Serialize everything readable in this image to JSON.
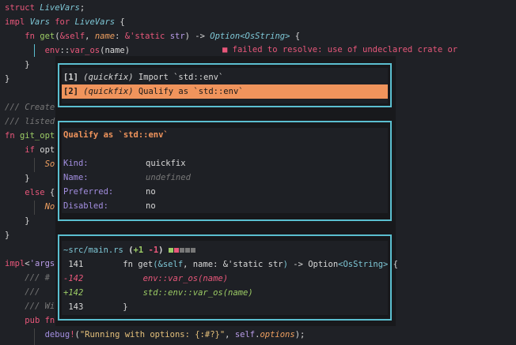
{
  "code": [
    {
      "t": 10,
      "parts": [
        [
          "kw",
          "struct "
        ],
        [
          "ty",
          "LiveVars"
        ],
        [
          "",
          "; "
        ]
      ]
    },
    {
      "t": 28,
      "parts": [
        [
          "kw",
          "impl "
        ],
        [
          "ty",
          "Vars"
        ],
        [
          "kw",
          " for "
        ],
        [
          "ty",
          "LiveVars"
        ],
        [
          "",
          " {"
        ]
      ]
    },
    {
      "t": 46,
      "parts": [
        [
          "",
          "    "
        ],
        [
          "kw",
          "fn "
        ],
        [
          "fn",
          "get"
        ],
        [
          "",
          "("
        ],
        [
          "kw",
          "&self"
        ],
        [
          "",
          ", "
        ],
        [
          "par",
          "name"
        ],
        [
          "",
          ": "
        ],
        [
          "kw",
          "&'static "
        ],
        [
          "self",
          "str"
        ],
        [
          "",
          ") -> "
        ],
        [
          "ty",
          "Option"
        ],
        [
          "ty",
          "<OsString>"
        ],
        [
          "",
          " {"
        ]
      ]
    },
    {
      "t": 64,
      "parts": [
        [
          "",
          "        "
        ],
        [
          "kw",
          "env"
        ],
        [
          "",
          "::"
        ],
        [
          "kw",
          "var_os"
        ],
        [
          "",
          "(name)"
        ]
      ]
    },
    {
      "t": 82,
      "parts": [
        [
          "",
          "    }"
        ]
      ]
    },
    {
      "t": 100,
      "parts": [
        [
          "",
          "}"
        ]
      ]
    },
    {
      "t": 136,
      "parts": [
        [
          "cm",
          "/// Create"
        ]
      ]
    },
    {
      "t": 154,
      "parts": [
        [
          "cm",
          "/// listed"
        ]
      ]
    },
    {
      "t": 172,
      "parts": [
        [
          "kw",
          "fn "
        ],
        [
          "fn",
          "git_opt"
        ]
      ]
    },
    {
      "t": 190,
      "parts": [
        [
          "",
          "    "
        ],
        [
          "kw",
          "if "
        ],
        [
          "",
          "opt"
        ]
      ]
    },
    {
      "t": 208,
      "parts": [
        [
          "",
          "        "
        ],
        [
          "par",
          "So"
        ]
      ]
    },
    {
      "t": 226,
      "parts": [
        [
          "",
          "    }"
        ]
      ]
    },
    {
      "t": 244,
      "parts": [
        [
          "",
          "    "
        ],
        [
          "kw",
          "else "
        ],
        [
          "",
          "{"
        ]
      ]
    },
    {
      "t": 262,
      "parts": [
        [
          "",
          "        "
        ],
        [
          "par",
          "No"
        ]
      ]
    },
    {
      "t": 280,
      "parts": [
        [
          "",
          "    }"
        ]
      ]
    },
    {
      "t": 298,
      "parts": [
        [
          "",
          "}"
        ]
      ]
    },
    {
      "t": 334,
      "parts": [
        [
          "kw",
          "impl"
        ],
        [
          "",
          "<"
        ],
        [
          "self",
          "'args"
        ]
      ]
    },
    {
      "t": 352,
      "parts": [
        [
          "",
          "    "
        ],
        [
          "cm",
          "/// #"
        ]
      ]
    },
    {
      "t": 370,
      "parts": [
        [
          "",
          "    "
        ],
        [
          "cm",
          "///"
        ]
      ]
    },
    {
      "t": 388,
      "parts": [
        [
          "",
          "    "
        ],
        [
          "cm",
          "/// Wi"
        ]
      ]
    },
    {
      "t": 406,
      "parts": [
        [
          "",
          "    "
        ],
        [
          "kw",
          "pub fn"
        ]
      ]
    },
    {
      "t": 424,
      "parts": [
        [
          "",
          "        "
        ],
        [
          "mac",
          "debug"
        ],
        [
          "kw",
          "!"
        ],
        [
          "",
          "("
        ],
        [
          "str",
          "\"Running with options: {:#?}\""
        ],
        [
          "",
          ", "
        ],
        [
          "self",
          "self"
        ],
        [
          "",
          "."
        ],
        [
          "par",
          "options"
        ],
        [
          "",
          ");"
        ]
      ]
    }
  ],
  "diagnostic": "■ failed to resolve: use of undeclared crate or",
  "actions": {
    "items": [
      {
        "index": "[1]",
        "kind": "(quickfix)",
        "label": "Import `std::env`"
      },
      {
        "index": "[2]",
        "kind": "(quickfix)",
        "label": "Qualify as `std::env`"
      }
    ],
    "selected": 1
  },
  "details": {
    "title": "Qualify as `std::env`",
    "fields": [
      {
        "label": "Kind:",
        "value": "quickfix"
      },
      {
        "label": "Name:",
        "value": "undefined"
      },
      {
        "label": "Preferred:",
        "value": "no"
      },
      {
        "label": "Disabled:",
        "value": "no"
      }
    ]
  },
  "diff": {
    "file": "~src/main.rs",
    "added": "+1",
    "removed": "-1",
    "lines": [
      {
        "num": " 141",
        "type": "ctx",
        "parts": [
          [
            "",
            "    fn get"
          ],
          [
            "ty2",
            "(&self"
          ],
          [
            "",
            ", name: &'static str"
          ],
          [
            "ty2",
            ")"
          ],
          [
            "",
            " -> Option"
          ],
          [
            "ty2",
            "<OsString>"
          ],
          [
            "",
            " {"
          ]
        ]
      },
      {
        "num": "-142",
        "type": "del",
        "parts": [
          [
            "",
            "        env::var_os(name)"
          ]
        ]
      },
      {
        "num": "+142",
        "type": "add",
        "parts": [
          [
            "",
            "        std::env::var_os(name)"
          ]
        ]
      },
      {
        "num": " 143",
        "type": "ctx",
        "parts": [
          [
            "",
            "    }"
          ]
        ]
      }
    ]
  },
  "colors": {
    "border": "#5bbfd0",
    "selection": "#f0945c",
    "error": "#e8577a",
    "added": "#9ccc65"
  }
}
